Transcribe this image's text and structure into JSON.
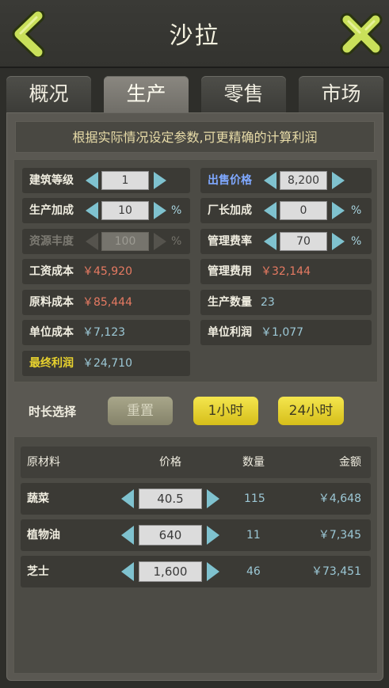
{
  "header": {
    "title": "沙拉"
  },
  "tabs": [
    {
      "label": "概况"
    },
    {
      "label": "生产"
    },
    {
      "label": "零售"
    },
    {
      "label": "市场"
    }
  ],
  "notice": "根据实际情况设定参数,可更精确的计算利润",
  "params": {
    "building_level": {
      "label": "建筑等级",
      "value": "1"
    },
    "sale_price": {
      "label": "出售价格",
      "value": "8,200"
    },
    "production_bonus": {
      "label": "生产加成",
      "value": "10",
      "unit": "%"
    },
    "manager_bonus": {
      "label": "厂长加成",
      "value": "0",
      "unit": "%"
    },
    "resource_richness": {
      "label": "资源丰度",
      "value": "100",
      "unit": "%"
    },
    "management_fee_rate": {
      "label": "管理费率",
      "value": "70",
      "unit": "%"
    },
    "wage_cost": {
      "label": "工资成本",
      "value": "￥45,920"
    },
    "management_fee": {
      "label": "管理费用",
      "value": "￥32,144"
    },
    "material_cost": {
      "label": "原料成本",
      "value": "￥85,444"
    },
    "production_qty": {
      "label": "生产数量",
      "value": "23"
    },
    "unit_cost": {
      "label": "单位成本",
      "value": "￥7,123"
    },
    "unit_profit": {
      "label": "单位利润",
      "value": "￥1,077"
    },
    "final_profit": {
      "label": "最终利润",
      "value": "￥24,710"
    }
  },
  "duration": {
    "label": "时长选择",
    "reset": "重置",
    "hour1": "1小时",
    "hour24": "24小时"
  },
  "materials": {
    "headers": {
      "name": "原材料",
      "price": "价格",
      "qty": "数量",
      "amount": "金额"
    },
    "rows": [
      {
        "name": "蔬菜",
        "price": "40.5",
        "qty": "115",
        "amount": "￥4,648"
      },
      {
        "name": "植物油",
        "price": "640",
        "qty": "11",
        "amount": "￥7,345"
      },
      {
        "name": "芝士",
        "price": "1,600",
        "qty": "46",
        "amount": "￥73,451"
      }
    ]
  },
  "colors": {
    "accent_yellow": "#e8d22e",
    "arrow_cyan": "#7fc2cf",
    "cost_red": "#e67a62",
    "value_cyan": "#9cc8d6",
    "blue_label": "#7fa8ff"
  }
}
